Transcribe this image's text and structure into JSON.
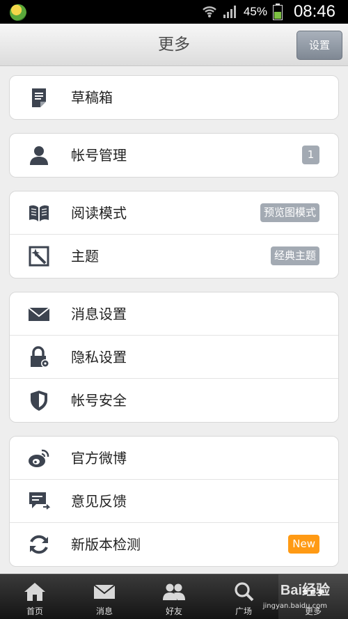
{
  "status_bar": {
    "battery_percent": "45%",
    "time": "08:46"
  },
  "header": {
    "title": "更多",
    "settings_button": "设置"
  },
  "groups": [
    {
      "items": [
        {
          "label": "草稿箱",
          "icon": "drafts-icon"
        }
      ]
    },
    {
      "items": [
        {
          "label": "帐号管理",
          "icon": "user-icon",
          "badge": "1"
        }
      ]
    },
    {
      "items": [
        {
          "label": "阅读模式",
          "icon": "book-icon",
          "badge": "预览图模式"
        },
        {
          "label": "主题",
          "icon": "theme-wand-icon",
          "badge": "经典主题"
        }
      ]
    },
    {
      "items": [
        {
          "label": "消息设置",
          "icon": "envelope-icon"
        },
        {
          "label": "隐私设置",
          "icon": "lock-gear-icon"
        },
        {
          "label": "帐号安全",
          "icon": "shield-icon"
        }
      ]
    },
    {
      "items": [
        {
          "label": "官方微博",
          "icon": "weibo-icon"
        },
        {
          "label": "意见反馈",
          "icon": "feedback-icon"
        },
        {
          "label": "新版本检测",
          "icon": "refresh-icon",
          "badge": "New"
        }
      ]
    }
  ],
  "tab_bar": {
    "tabs": [
      {
        "label": "首页",
        "icon": "home-icon"
      },
      {
        "label": "消息",
        "icon": "message-icon"
      },
      {
        "label": "好友",
        "icon": "friends-icon"
      },
      {
        "label": "广场",
        "icon": "search-icon"
      },
      {
        "label": "更多",
        "icon": "more-icon"
      }
    ],
    "active_index": 4
  },
  "watermark": {
    "text": "Bai经验",
    "url_text": "jingyan.baidu.com"
  },
  "colors": {
    "new_badge": "#ff9a14",
    "badge": "#a3aab3",
    "icon": "#3d4450"
  }
}
